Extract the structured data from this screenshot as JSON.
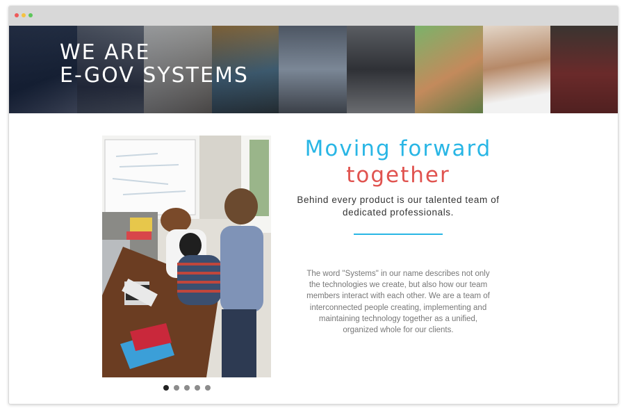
{
  "colors": {
    "accent_blue": "#29b6e5",
    "accent_red": "#e0534f",
    "window_close": "#ee5a5a",
    "window_minimize": "#f5c242",
    "window_maximize": "#5cc65a"
  },
  "hero": {
    "title_line1": "WE ARE",
    "title_line2": "E-GOV SYSTEMS"
  },
  "section": {
    "heading_line1": "Moving forward",
    "heading_line2": "together",
    "subtitle_line1": "Behind every product is our talented team of",
    "subtitle_line2": "dedicated professionals.",
    "body_lines": [
      "The word \"Systems\" in our name describes not only",
      "the technologies we create, but also how our team",
      "members interact with each other. We are a team of",
      "interconnected people creating, implementing and",
      "maintaining technology together as a unified,",
      "organized whole for our clients."
    ]
  },
  "carousel": {
    "slide_count": 5,
    "active_index": 0
  }
}
